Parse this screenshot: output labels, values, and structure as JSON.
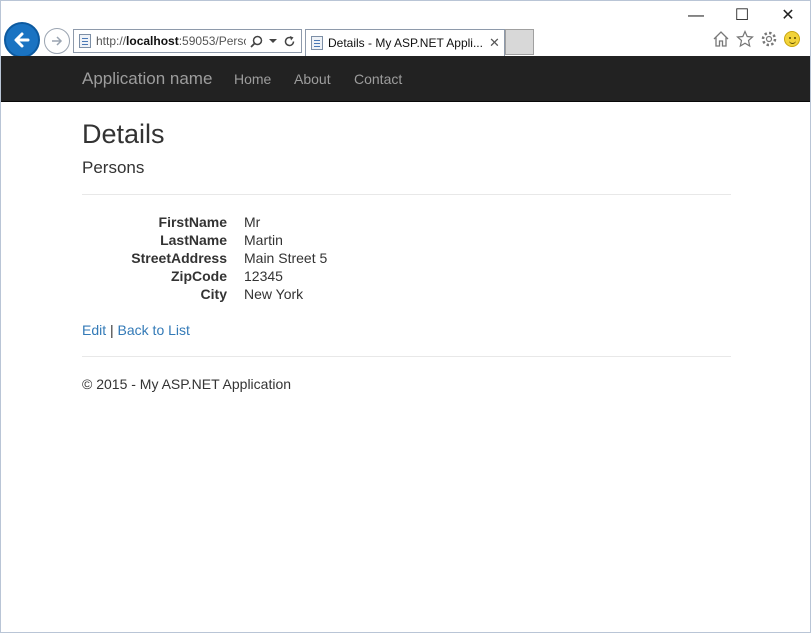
{
  "browser": {
    "url_prefix": "http://",
    "url_host": "localhost",
    "url_rest": ":59053/Persc",
    "tab_title": "Details - My ASP.NET Appli...",
    "window_controls": {
      "minimize": "—",
      "maximize": "☐",
      "close": "✕"
    },
    "icons": [
      "back-arrow-icon",
      "forward-arrow-icon",
      "page-icon",
      "search-icon",
      "dropdown-icon",
      "refresh-icon",
      "home-icon",
      "star-icon",
      "gear-icon",
      "smiley-icon"
    ]
  },
  "navbar": {
    "brand": "Application name",
    "links": [
      "Home",
      "About",
      "Contact"
    ],
    "background": "#222222",
    "text_color": "#9d9d9d"
  },
  "main": {
    "title": "Details",
    "subtitle": "Persons",
    "fields": [
      {
        "label": "FirstName",
        "value": "Mr"
      },
      {
        "label": "LastName",
        "value": "Martin"
      },
      {
        "label": "StreetAddress",
        "value": "Main Street 5"
      },
      {
        "label": "ZipCode",
        "value": "12345"
      },
      {
        "label": "City",
        "value": "New York"
      }
    ],
    "actions": {
      "edit": "Edit",
      "separator": "|",
      "back": "Back to List"
    },
    "link_color": "#337ab7"
  },
  "footer": {
    "text": "© 2015 - My ASP.NET Application"
  }
}
